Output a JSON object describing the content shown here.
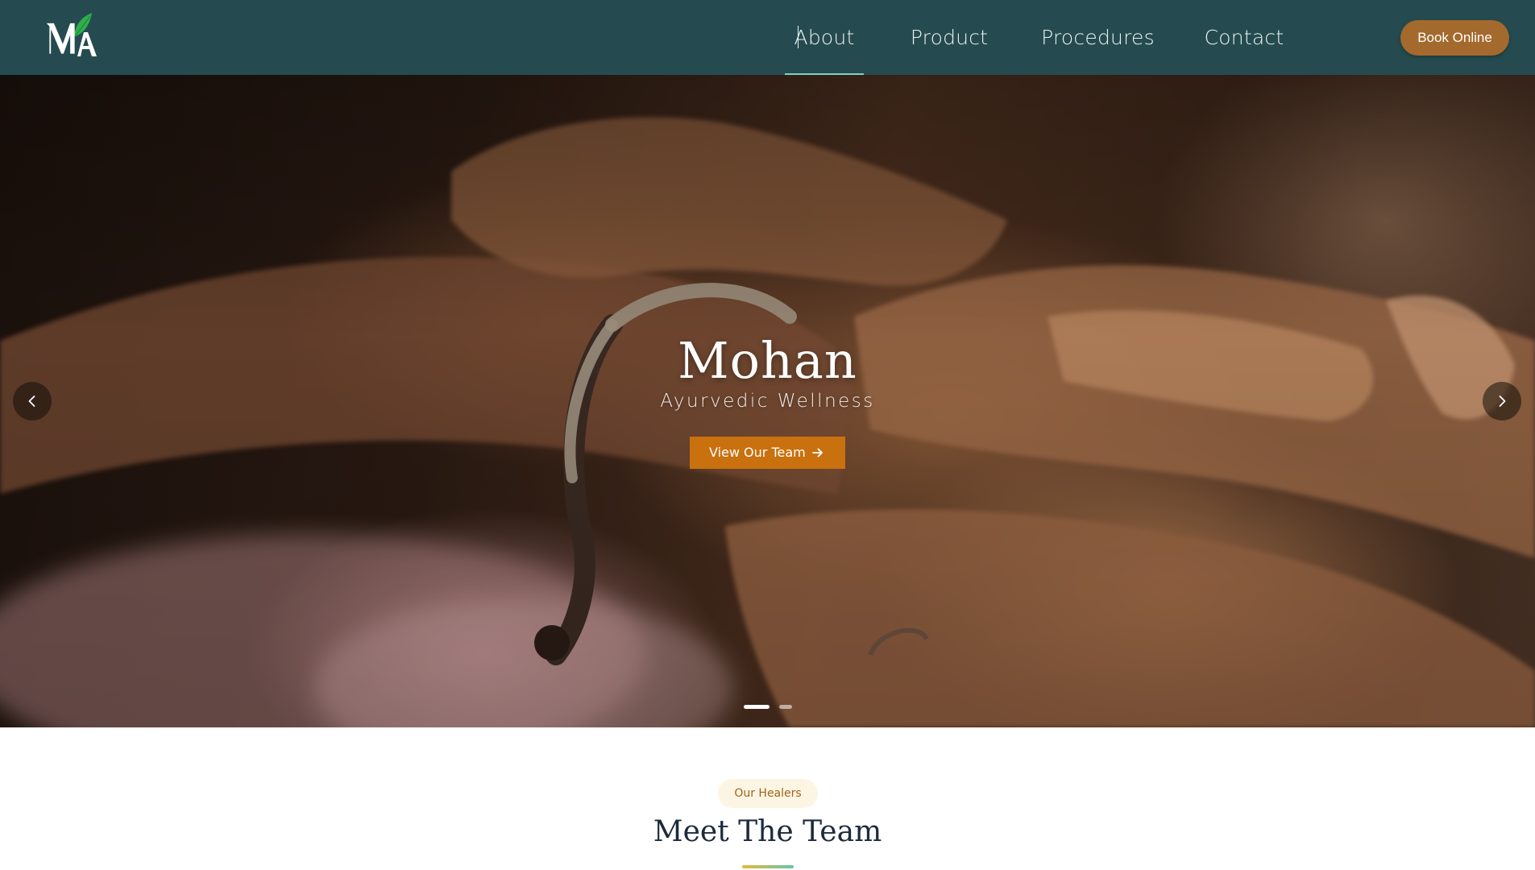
{
  "header": {
    "logo_text": "MA",
    "nav": [
      {
        "label": "About",
        "active": true
      },
      {
        "label": "Product",
        "active": false
      },
      {
        "label": "Procedures",
        "active": false
      },
      {
        "label": "Contact",
        "active": false
      }
    ],
    "book_button": "Book Online"
  },
  "hero": {
    "title": "Mohan",
    "subtitle": "Ayurvedic Wellness",
    "cta_label": "View Our Team",
    "prev_icon": "chevron-left-icon",
    "next_icon": "chevron-right-icon",
    "slide_count": 2,
    "active_slide": 1
  },
  "team_section": {
    "badge": "Our Healers",
    "title": "Meet The Team"
  },
  "colors": {
    "nav_bg": "#254b50",
    "book_button": "#a4692c",
    "cta": "#c9700f",
    "badge_bg": "#fdf5e3",
    "badge_text": "#a0641e",
    "heading": "#1c2a3c"
  }
}
